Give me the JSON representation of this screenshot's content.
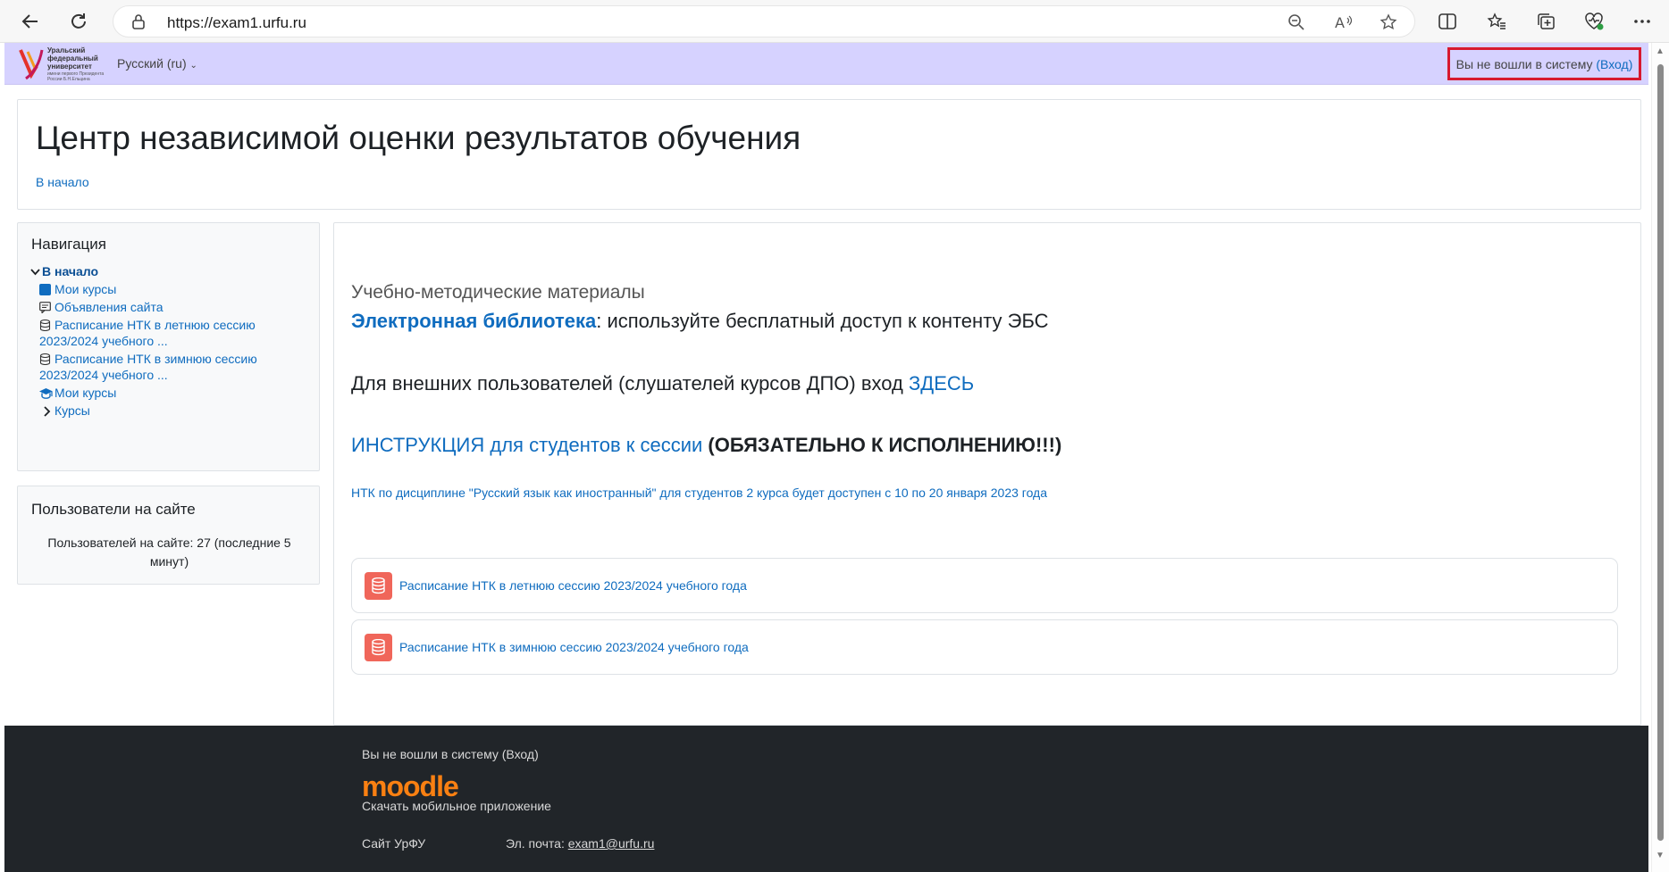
{
  "browser": {
    "url_host": "https://exam1.urfu.ru",
    "icons": [
      "back-icon",
      "reload-icon",
      "lock-icon",
      "zoom-out-icon",
      "read-aloud-icon",
      "favorite-star-icon",
      "split-screen-icon",
      "favorites-icon",
      "collections-icon",
      "browser-essentials-icon",
      "more-icon"
    ]
  },
  "navbar": {
    "logo_lines": [
      "Уральский",
      "федеральный",
      "университет"
    ],
    "logo_sub": "имени первого Президента России Б.Н.Ельцина",
    "language": "Русский (ru)",
    "login_prefix": "Вы не вошли в систему",
    "login_link": "(Вход)",
    "login_highlight_color": "#d7192f"
  },
  "header": {
    "title": "Центр независимой оценки результатов обучения",
    "breadcrumb": "В начало"
  },
  "navigation": {
    "title": "Навигация",
    "home": "В начало",
    "items": [
      {
        "label": "Мои курсы",
        "icon": "square-icon"
      },
      {
        "label": "Объявления сайта",
        "icon": "forum-icon"
      },
      {
        "label": "Расписание НТК в летнюю сессию",
        "label2": "2023/2024 учебного ...",
        "icon": "database-icon"
      },
      {
        "label": "Расписание НТК в зимнюю сессию",
        "label2": "2023/2024 учебного ...",
        "icon": "database-icon"
      },
      {
        "label": "Мои курсы",
        "icon": "graduation-cap-icon"
      },
      {
        "label": "Курсы",
        "icon": "chevron-right-icon"
      }
    ]
  },
  "users_online": {
    "title": "Пользователи на сайте",
    "text": "Пользователей на сайте: 27 (последние 5 минут)"
  },
  "main": {
    "subtitle": "Учебно-методические материалы",
    "library_link": "Электронная библиотека",
    "library_text": ": используйте бесплатный доступ к контенту ЭБС",
    "external_text": "Для внешних пользователей (слушателей курсов ДПО) вход ",
    "external_link": "ЗДЕСЬ",
    "instruction_link": "ИНСТРУКЦИЯ для студентов к сессии",
    "instruction_bold": " (ОБЯЗАТЕЛЬНО К ИСПОЛНЕНИЮ!!!)",
    "notice": "НТК по дисциплине \"Русский язык как иностранный\" для студентов 2 курса будет доступен с 10 по 20 января 2023 года",
    "activities": [
      {
        "label": "Расписание НТК в летнюю сессию 2023/2024 учебного года"
      },
      {
        "label": "Расписание НТК в зимнюю сессию 2023/2024 учебного года"
      }
    ]
  },
  "footer": {
    "login_text": "Вы не вошли в систему (Вход)",
    "moodle_logo": "moodle",
    "app_text": "Скачать мобильное приложение",
    "site_link": "Сайт УрФУ",
    "email_label": "Эл. почта: ",
    "email": "exam1@urfu.ru"
  }
}
